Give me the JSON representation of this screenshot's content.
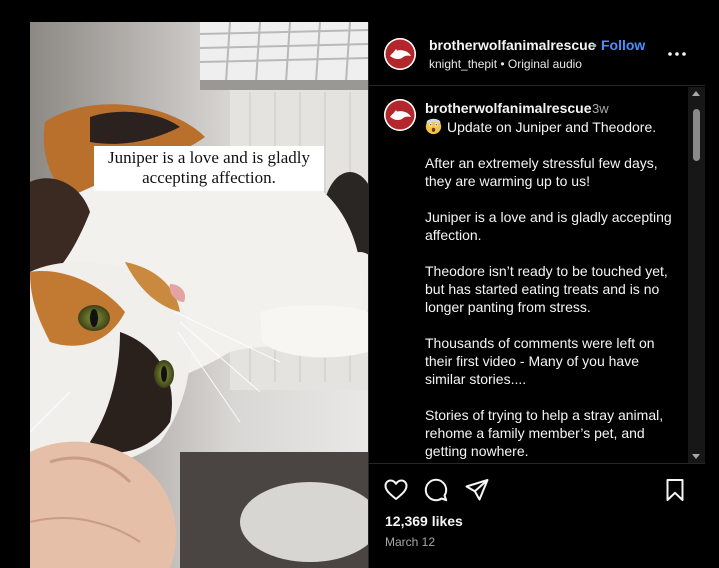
{
  "media": {
    "overlay_text": "Juniper is a love and is gladly accepting affection."
  },
  "header": {
    "username": "brotherwolfanimalrescue",
    "separator": "•",
    "follow_label": "Follow",
    "audio": "knight_thepit • Original audio"
  },
  "caption": {
    "username": "brotherwolfanimalrescue",
    "time": "3w",
    "emoji_icon": "astonished-face-icon",
    "paragraphs": [
      "Update on Juniper and Theodore.",
      "After an extremely stressful few days, they are warming up to us!",
      "Juniper is a love and is gladly accepting affection.",
      "Theodore isn’t ready to be touched yet, but has started eating treats and is no longer panting from stress.",
      "Thousands of comments were left on their first video - Many of you have similar stories....",
      "Stories of trying to help a stray animal, rehome a family member’s pet, and getting nowhere."
    ]
  },
  "footer": {
    "likes": "12,369 likes",
    "date": "March 12"
  },
  "icons": {
    "like": "heart-icon",
    "comment": "comment-icon",
    "share": "share-icon",
    "save": "bookmark-icon",
    "more": "more-icon"
  },
  "colors": {
    "background": "#000000",
    "follow": "#4a90ff",
    "secondary_text": "#a8a8a8",
    "brand_red": "#b3262b"
  }
}
